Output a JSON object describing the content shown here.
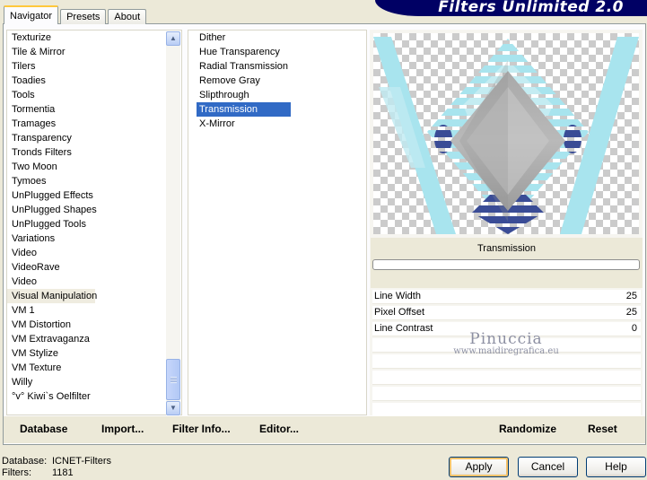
{
  "tabs": [
    {
      "label": "Navigator",
      "active": true
    },
    {
      "label": "Presets",
      "active": false
    },
    {
      "label": "About",
      "active": false
    }
  ],
  "banner_title": "Filters Unlimited 2.0",
  "categories": [
    "Texturize",
    "Tile & Mirror",
    "Tilers",
    "Toadies",
    "Tools",
    "Tormentia",
    "Tramages",
    "Transparency",
    "Tronds Filters",
    "Two Moon",
    "Tymoes",
    "UnPlugged Effects",
    "UnPlugged Shapes",
    "UnPlugged Tools",
    "Variations",
    "Video",
    "VideoRave",
    "Video",
    "Visual Manipulation",
    "VM 1",
    "VM Distortion",
    "VM Extravaganza",
    "VM Stylize",
    "VM Texture",
    "Willy",
    "°v° Kiwi`s Oelfilter"
  ],
  "selected_category": "Visual Manipulation",
  "filters": [
    "Dither",
    "Hue Transparency",
    "Radial Transmission",
    "Remove Gray",
    "Slipthrough",
    "Transmission",
    "X-Mirror"
  ],
  "selected_filter": "Transmission",
  "preview": {
    "filter_name": "Transmission"
  },
  "params": [
    {
      "label": "Line Width",
      "value": "25"
    },
    {
      "label": "Pixel Offset",
      "value": "25"
    },
    {
      "label": "Line Contrast",
      "value": "0"
    }
  ],
  "watermark": {
    "name": "Pinuccia",
    "url": "www.maidiregrafica.eu"
  },
  "bottom_buttons": {
    "database": "Database",
    "import": "Import...",
    "filter_info": "Filter Info...",
    "editor": "Editor...",
    "randomize": "Randomize",
    "reset": "Reset"
  },
  "status": {
    "database_label": "Database:",
    "database_value": "ICNET-Filters",
    "filters_label": "Filters:",
    "filters_value": "1181"
  },
  "actions": {
    "apply": "Apply",
    "cancel": "Cancel",
    "help": "Help"
  },
  "colors": {
    "selection": "#316ac5",
    "banner": "#000064",
    "preview_cyan": "#a8e4ee",
    "preview_blue": "#3a4c96"
  }
}
